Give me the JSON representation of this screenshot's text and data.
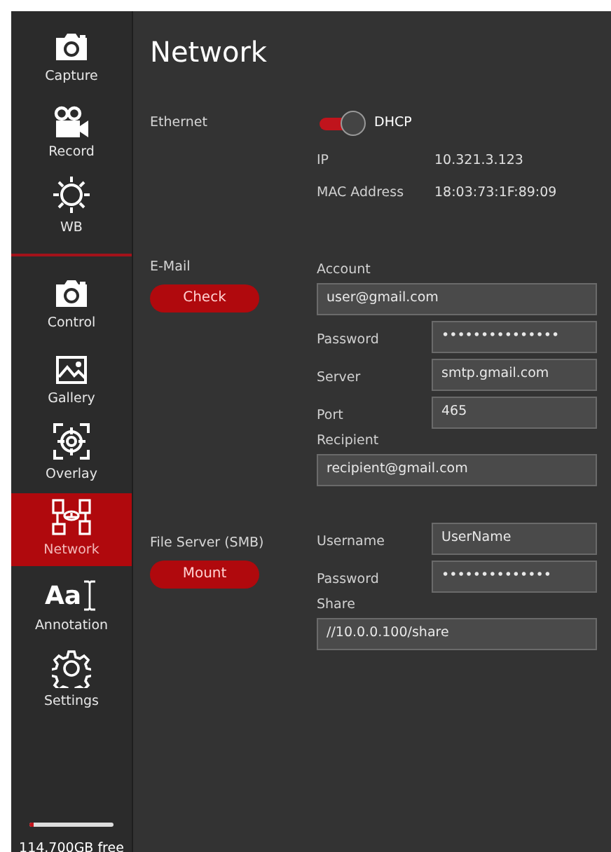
{
  "sidebar": {
    "top_items": [
      {
        "kind": "camera",
        "label": "Capture",
        "selected": false
      },
      {
        "kind": "video",
        "label": "Record",
        "selected": false
      },
      {
        "kind": "sun",
        "label": "WB",
        "selected": false
      }
    ],
    "items": [
      {
        "kind": "camera",
        "label": "Control",
        "selected": false
      },
      {
        "kind": "image",
        "label": "Gallery",
        "selected": false
      },
      {
        "kind": "target",
        "label": "Overlay",
        "selected": false
      },
      {
        "kind": "network",
        "label": "Network",
        "selected": true
      },
      {
        "kind": "text",
        "glyph": "Aa",
        "label": "Annotation",
        "selected": false
      },
      {
        "kind": "gear",
        "label": "Settings",
        "selected": false
      }
    ],
    "storage": {
      "level": 0.05,
      "label": "114.700GB free"
    }
  },
  "title": "Network",
  "sections": [
    {
      "kind": "ethernet",
      "label": "Ethernet",
      "toggle": {
        "label": "DHCP",
        "on": true
      },
      "info": [
        {
          "label": "IP",
          "value": "10.321.3.123"
        },
        {
          "label": "MAC Address",
          "value": "18:03:73:1F:89:09"
        }
      ]
    },
    {
      "kind": "form",
      "label": "E-Mail",
      "button": "Check",
      "fields": [
        {
          "kind": "stacked",
          "label": "Account",
          "value": "user@gmail.com"
        },
        {
          "kind": "inline",
          "label": "Password",
          "value": "•••••••••••••••"
        },
        {
          "kind": "inline",
          "label": "Server",
          "value": "smtp.gmail.com"
        },
        {
          "kind": "inline",
          "label": "Port",
          "value": "465"
        },
        {
          "kind": "stacked",
          "label": "Recipient",
          "value": "recipient@gmail.com"
        }
      ]
    },
    {
      "kind": "form",
      "label": "File Server (SMB)",
      "button": "Mount",
      "fields": [
        {
          "kind": "inline",
          "label": "Username",
          "value": "UserName"
        },
        {
          "kind": "inline",
          "label": "Password",
          "value": "••••••••••••••"
        },
        {
          "kind": "stacked",
          "label": "Share",
          "value": "//10.0.0.100/share"
        }
      ]
    }
  ]
}
